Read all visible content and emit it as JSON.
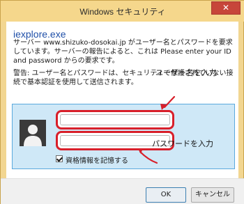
{
  "window": {
    "title": "Windows セキュリティ",
    "close_symbol": "✕"
  },
  "dialog": {
    "app_title": "iexplore.exe",
    "message": "サーバー www.shizuko-dosokai.jp がユーザー名とパスワードを要求しています。サーバーの報告によると、これは Please enter your ID and password からの要求です。",
    "warning": "警告: ユーザー名とパスワードは、セキュリティで保護されていない接続で基本認証を使用して送信されます。"
  },
  "credentials": {
    "username_value": "",
    "password_value": "",
    "remember_label": "資格情報を記憶する",
    "remember_checked": true
  },
  "annotations": {
    "username": "ユーザー名を入力",
    "password": "パスワードを入力",
    "color": "#d81f2a"
  },
  "buttons": {
    "ok": "OK",
    "cancel": "キャンセル"
  },
  "icons": {
    "avatar": "user-avatar-icon",
    "close": "close-icon",
    "checkbox": "checkbox-checked-icon"
  }
}
